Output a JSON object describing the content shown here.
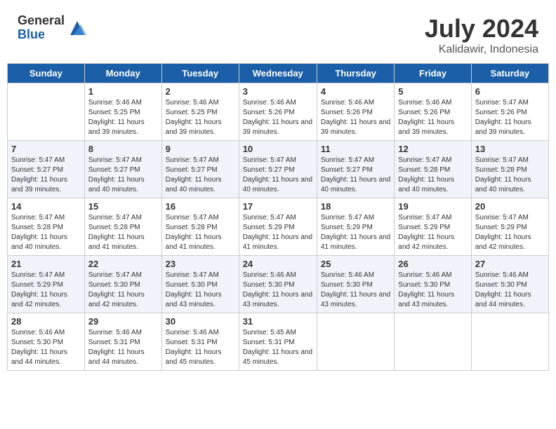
{
  "header": {
    "logo_general": "General",
    "logo_blue": "Blue",
    "month_title": "July 2024",
    "location": "Kalidawir, Indonesia"
  },
  "weekdays": [
    "Sunday",
    "Monday",
    "Tuesday",
    "Wednesday",
    "Thursday",
    "Friday",
    "Saturday"
  ],
  "weeks": [
    [
      {
        "day": "",
        "sunrise": "",
        "sunset": "",
        "daylight": ""
      },
      {
        "day": "1",
        "sunrise": "Sunrise: 5:46 AM",
        "sunset": "Sunset: 5:25 PM",
        "daylight": "Daylight: 11 hours and 39 minutes."
      },
      {
        "day": "2",
        "sunrise": "Sunrise: 5:46 AM",
        "sunset": "Sunset: 5:25 PM",
        "daylight": "Daylight: 11 hours and 39 minutes."
      },
      {
        "day": "3",
        "sunrise": "Sunrise: 5:46 AM",
        "sunset": "Sunset: 5:26 PM",
        "daylight": "Daylight: 11 hours and 39 minutes."
      },
      {
        "day": "4",
        "sunrise": "Sunrise: 5:46 AM",
        "sunset": "Sunset: 5:26 PM",
        "daylight": "Daylight: 11 hours and 39 minutes."
      },
      {
        "day": "5",
        "sunrise": "Sunrise: 5:46 AM",
        "sunset": "Sunset: 5:26 PM",
        "daylight": "Daylight: 11 hours and 39 minutes."
      },
      {
        "day": "6",
        "sunrise": "Sunrise: 5:47 AM",
        "sunset": "Sunset: 5:26 PM",
        "daylight": "Daylight: 11 hours and 39 minutes."
      }
    ],
    [
      {
        "day": "7",
        "sunrise": "Sunrise: 5:47 AM",
        "sunset": "Sunset: 5:27 PM",
        "daylight": "Daylight: 11 hours and 39 minutes."
      },
      {
        "day": "8",
        "sunrise": "Sunrise: 5:47 AM",
        "sunset": "Sunset: 5:27 PM",
        "daylight": "Daylight: 11 hours and 40 minutes."
      },
      {
        "day": "9",
        "sunrise": "Sunrise: 5:47 AM",
        "sunset": "Sunset: 5:27 PM",
        "daylight": "Daylight: 11 hours and 40 minutes."
      },
      {
        "day": "10",
        "sunrise": "Sunrise: 5:47 AM",
        "sunset": "Sunset: 5:27 PM",
        "daylight": "Daylight: 11 hours and 40 minutes."
      },
      {
        "day": "11",
        "sunrise": "Sunrise: 5:47 AM",
        "sunset": "Sunset: 5:27 PM",
        "daylight": "Daylight: 11 hours and 40 minutes."
      },
      {
        "day": "12",
        "sunrise": "Sunrise: 5:47 AM",
        "sunset": "Sunset: 5:28 PM",
        "daylight": "Daylight: 11 hours and 40 minutes."
      },
      {
        "day": "13",
        "sunrise": "Sunrise: 5:47 AM",
        "sunset": "Sunset: 5:28 PM",
        "daylight": "Daylight: 11 hours and 40 minutes."
      }
    ],
    [
      {
        "day": "14",
        "sunrise": "Sunrise: 5:47 AM",
        "sunset": "Sunset: 5:28 PM",
        "daylight": "Daylight: 11 hours and 40 minutes."
      },
      {
        "day": "15",
        "sunrise": "Sunrise: 5:47 AM",
        "sunset": "Sunset: 5:28 PM",
        "daylight": "Daylight: 11 hours and 41 minutes."
      },
      {
        "day": "16",
        "sunrise": "Sunrise: 5:47 AM",
        "sunset": "Sunset: 5:28 PM",
        "daylight": "Daylight: 11 hours and 41 minutes."
      },
      {
        "day": "17",
        "sunrise": "Sunrise: 5:47 AM",
        "sunset": "Sunset: 5:29 PM",
        "daylight": "Daylight: 11 hours and 41 minutes."
      },
      {
        "day": "18",
        "sunrise": "Sunrise: 5:47 AM",
        "sunset": "Sunset: 5:29 PM",
        "daylight": "Daylight: 11 hours and 41 minutes."
      },
      {
        "day": "19",
        "sunrise": "Sunrise: 5:47 AM",
        "sunset": "Sunset: 5:29 PM",
        "daylight": "Daylight: 11 hours and 42 minutes."
      },
      {
        "day": "20",
        "sunrise": "Sunrise: 5:47 AM",
        "sunset": "Sunset: 5:29 PM",
        "daylight": "Daylight: 11 hours and 42 minutes."
      }
    ],
    [
      {
        "day": "21",
        "sunrise": "Sunrise: 5:47 AM",
        "sunset": "Sunset: 5:29 PM",
        "daylight": "Daylight: 11 hours and 42 minutes."
      },
      {
        "day": "22",
        "sunrise": "Sunrise: 5:47 AM",
        "sunset": "Sunset: 5:30 PM",
        "daylight": "Daylight: 11 hours and 42 minutes."
      },
      {
        "day": "23",
        "sunrise": "Sunrise: 5:47 AM",
        "sunset": "Sunset: 5:30 PM",
        "daylight": "Daylight: 11 hours and 43 minutes."
      },
      {
        "day": "24",
        "sunrise": "Sunrise: 5:46 AM",
        "sunset": "Sunset: 5:30 PM",
        "daylight": "Daylight: 11 hours and 43 minutes."
      },
      {
        "day": "25",
        "sunrise": "Sunrise: 5:46 AM",
        "sunset": "Sunset: 5:30 PM",
        "daylight": "Daylight: 11 hours and 43 minutes."
      },
      {
        "day": "26",
        "sunrise": "Sunrise: 5:46 AM",
        "sunset": "Sunset: 5:30 PM",
        "daylight": "Daylight: 11 hours and 43 minutes."
      },
      {
        "day": "27",
        "sunrise": "Sunrise: 5:46 AM",
        "sunset": "Sunset: 5:30 PM",
        "daylight": "Daylight: 11 hours and 44 minutes."
      }
    ],
    [
      {
        "day": "28",
        "sunrise": "Sunrise: 5:46 AM",
        "sunset": "Sunset: 5:30 PM",
        "daylight": "Daylight: 11 hours and 44 minutes."
      },
      {
        "day": "29",
        "sunrise": "Sunrise: 5:46 AM",
        "sunset": "Sunset: 5:31 PM",
        "daylight": "Daylight: 11 hours and 44 minutes."
      },
      {
        "day": "30",
        "sunrise": "Sunrise: 5:46 AM",
        "sunset": "Sunset: 5:31 PM",
        "daylight": "Daylight: 11 hours and 45 minutes."
      },
      {
        "day": "31",
        "sunrise": "Sunrise: 5:45 AM",
        "sunset": "Sunset: 5:31 PM",
        "daylight": "Daylight: 11 hours and 45 minutes."
      },
      {
        "day": "",
        "sunrise": "",
        "sunset": "",
        "daylight": ""
      },
      {
        "day": "",
        "sunrise": "",
        "sunset": "",
        "daylight": ""
      },
      {
        "day": "",
        "sunrise": "",
        "sunset": "",
        "daylight": ""
      }
    ]
  ]
}
